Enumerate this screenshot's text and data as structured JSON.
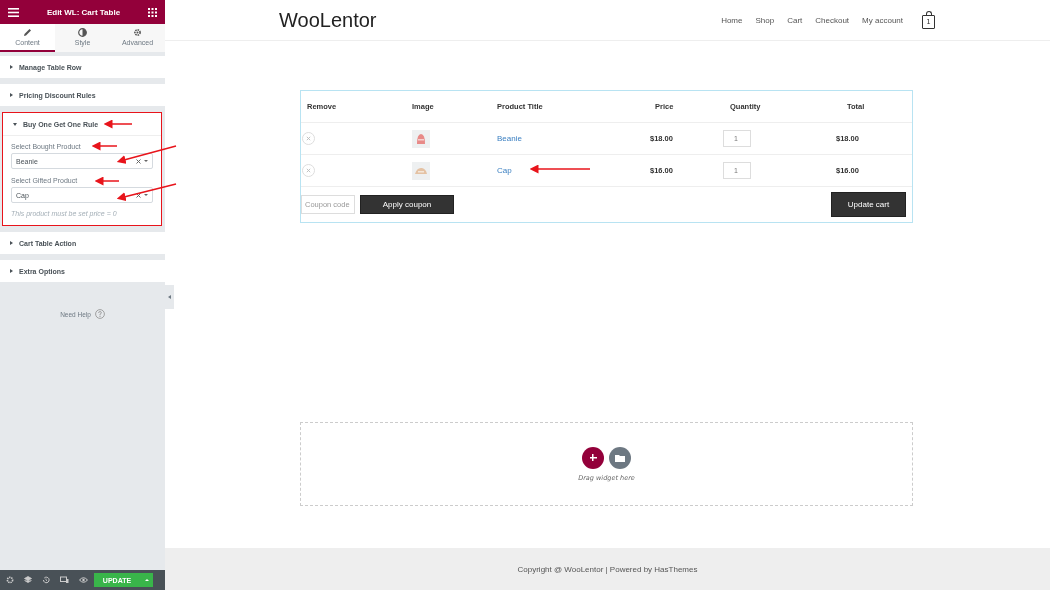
{
  "panel": {
    "title": "Edit WL: Cart Table",
    "tabs": [
      {
        "label": "Content",
        "selected": true
      },
      {
        "label": "Style",
        "selected": false
      },
      {
        "label": "Advanced",
        "selected": false
      }
    ],
    "sections": [
      {
        "title": "Manage Table Row",
        "expanded": false,
        "highlighted": false
      },
      {
        "title": "Pricing Discount Rules",
        "expanded": false,
        "highlighted": false
      },
      {
        "title": "Buy One Get One Rule",
        "expanded": true,
        "highlighted": true,
        "fields": [
          {
            "label": "Select Bought Product",
            "value": "Beanie"
          },
          {
            "label": "Select Gifted Product",
            "value": "Cap"
          }
        ],
        "note": "This product must be set price = 0"
      },
      {
        "title": "Cart Table Action",
        "expanded": false,
        "highlighted": false
      },
      {
        "title": "Extra Options",
        "expanded": false,
        "highlighted": false
      }
    ],
    "help": "Need Help",
    "update_button": "UPDATE"
  },
  "site": {
    "logo": "WooLentor",
    "nav": [
      "Home",
      "Shop",
      "Cart",
      "Checkout",
      "My account"
    ],
    "cart_count": "1"
  },
  "cart": {
    "columns": [
      "Remove",
      "Image",
      "Product Title",
      "Price",
      "Quantity",
      "Total"
    ],
    "rows": [
      {
        "title": "Beanie",
        "price": "$18.00",
        "quantity": "1",
        "total": "$18.00"
      },
      {
        "title": "Cap",
        "price": "$16.00",
        "quantity": "1",
        "total": "$16.00"
      }
    ],
    "coupon_placeholder": "Coupon code",
    "apply_button": "Apply coupon",
    "update_button": "Update cart"
  },
  "drop_zone": {
    "hint": "Drag widget here"
  },
  "footer": "Copyright @ WooLentor | Powered by HasThemes"
}
